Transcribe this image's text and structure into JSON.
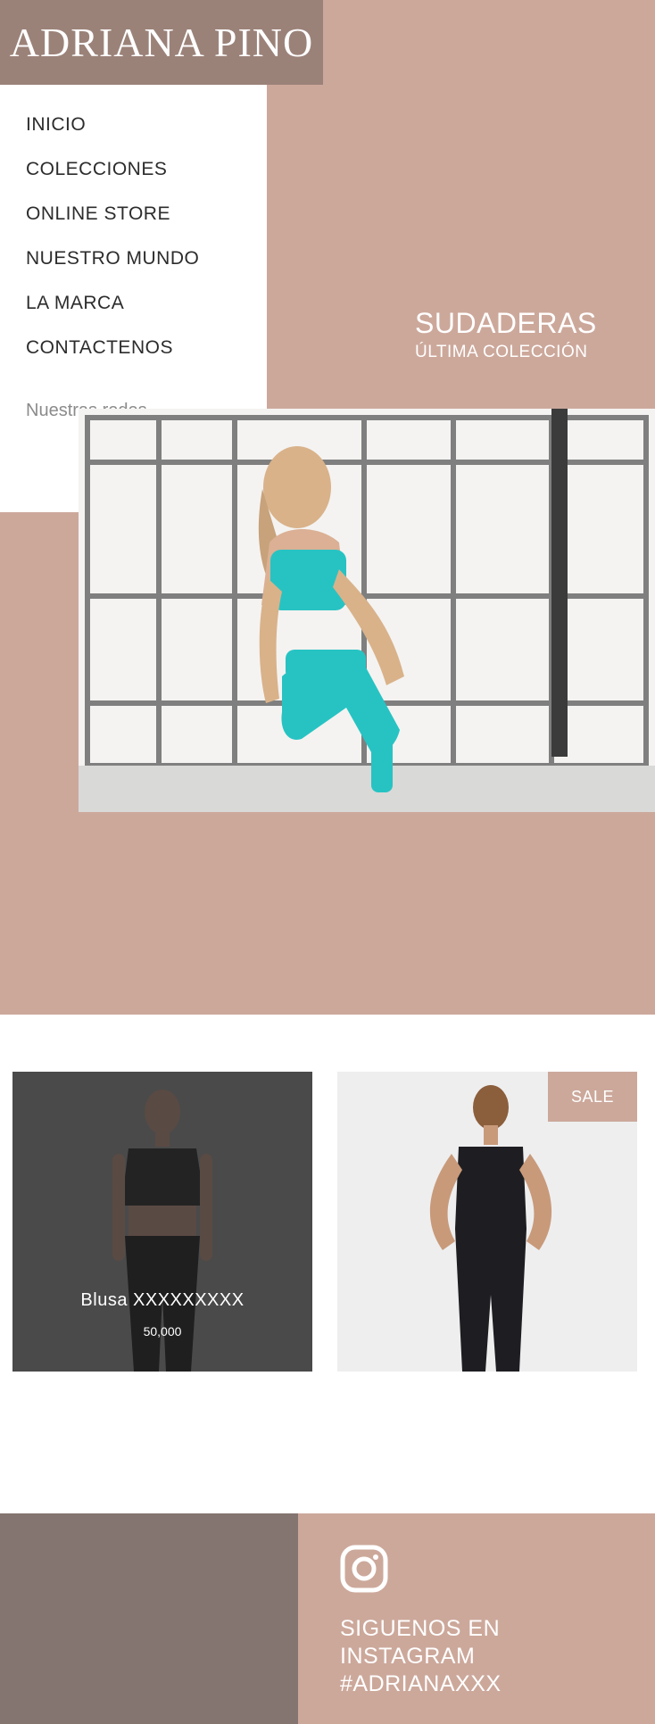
{
  "brand": {
    "name": "ADRIANA PINO"
  },
  "nav": {
    "items": [
      "INICIO",
      "COLECCIONES",
      "ONLINE STORE",
      "NUESTRO MUNDO",
      "LA MARCA",
      "CONTACTENOS"
    ],
    "socials_label": "Nuestras redes"
  },
  "hero": {
    "heading": "SUDADERAS",
    "subheading": "ÚLTIMA COLECCIÓN"
  },
  "products": [
    {
      "name": "Blusa XXXXXXXXX",
      "price": "50,000"
    },
    {
      "badge": "SALE"
    }
  ],
  "footer": {
    "instagram_lines": [
      "SIGUENOS EN",
      "INSTAGRAM",
      "#ADRIANAXXX"
    ]
  },
  "colors": {
    "accent": "#cca89b",
    "brand_box": "#9b8279",
    "footer_dark": "#847570"
  }
}
